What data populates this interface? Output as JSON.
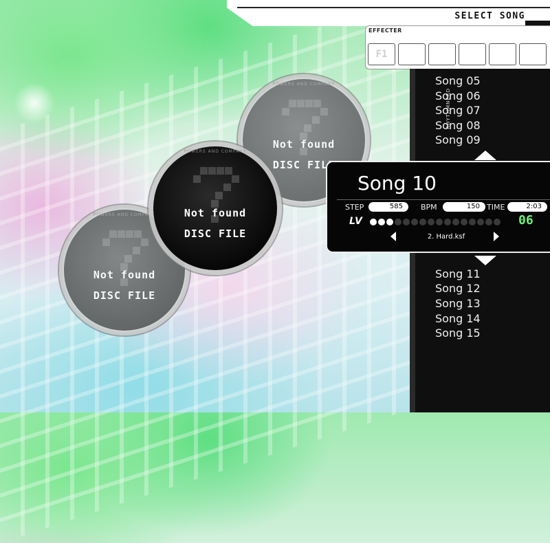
{
  "header": {
    "title": "SELECT SONG"
  },
  "effecter": {
    "title": "EFFECTER",
    "slots": [
      "F1",
      "",
      "",
      "",
      "",
      ""
    ]
  },
  "side_tag": "RHYTHMNERD",
  "song_list": {
    "above": [
      "Song 05",
      "Song 06",
      "Song 07",
      "Song 08",
      "Song 09"
    ],
    "below": [
      "Song 11",
      "Song 12",
      "Song 13",
      "Song 14",
      "Song 15"
    ]
  },
  "selected": {
    "title": "Song 10",
    "step_label": "STEP",
    "step": "585",
    "bpm_label": "BPM",
    "bpm": "150",
    "time_label": "TIME",
    "time": "2:03",
    "lv_label": "LV",
    "level": 3,
    "level_max": 16,
    "level_display": "06",
    "file": "2. Hard.ksf"
  },
  "discs": [
    {
      "line1": "Not found",
      "line2": "DISC FILE",
      "ring": "POWERS AND COMPANY"
    },
    {
      "line1": "Not found",
      "line2": "DISC FILE",
      "ring": "POWERS AND COMPANY"
    },
    {
      "line1": "Not found",
      "line2": "DISC FILE",
      "ring": "POWERS AND COMPANY"
    }
  ],
  "colors": {
    "level_on": "#ffffff",
    "level_off": "#3a3a3a",
    "level_number": "#6ef07a"
  }
}
